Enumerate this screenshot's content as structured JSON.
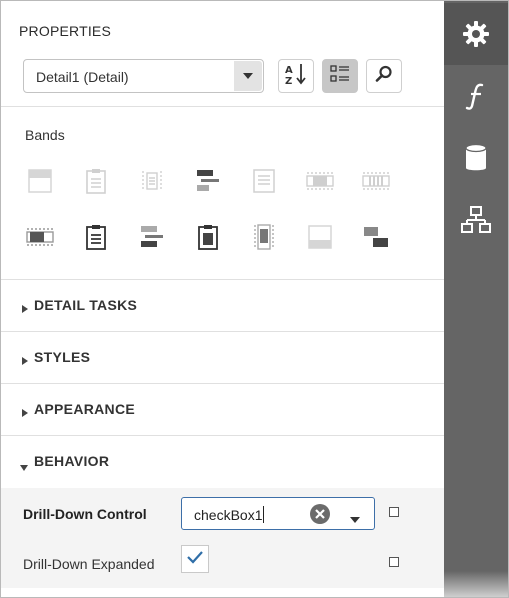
{
  "panel": {
    "title": "PROPERTIES",
    "selector": {
      "value": "Detail1 (Detail)"
    },
    "toolbar": [
      "sort-alphabetical",
      "categorized-view",
      "search"
    ]
  },
  "bands": {
    "label": "Bands",
    "items": [
      "top-margin-band",
      "report-header-band",
      "page-header-band",
      "group-header-band",
      "detail-band",
      "detail-report-band",
      "sub-band",
      "group-footer-band",
      "report-footer-band",
      "group-header-band-2",
      "page-footer-band",
      "vertical-band",
      "bottom-margin-band",
      "vertical-header-band"
    ]
  },
  "sections": [
    {
      "label": "DETAIL TASKS",
      "expanded": false
    },
    {
      "label": "STYLES",
      "expanded": false
    },
    {
      "label": "APPEARANCE",
      "expanded": false
    },
    {
      "label": "BEHAVIOR",
      "expanded": true
    }
  ],
  "behavior": {
    "drill_down_control": {
      "label": "Drill-Down Control",
      "value": "checkBox1"
    },
    "drill_down_expanded": {
      "label": "Drill-Down Expanded",
      "checked": true
    }
  },
  "rail": [
    "properties-gear-icon",
    "expressions-function-icon",
    "data-source-icon",
    "report-explorer-icon"
  ],
  "colors": {
    "rail": "#656565",
    "rail_active": "#555555",
    "focus": "#3d6fa8",
    "check": "#2f6ea8"
  }
}
